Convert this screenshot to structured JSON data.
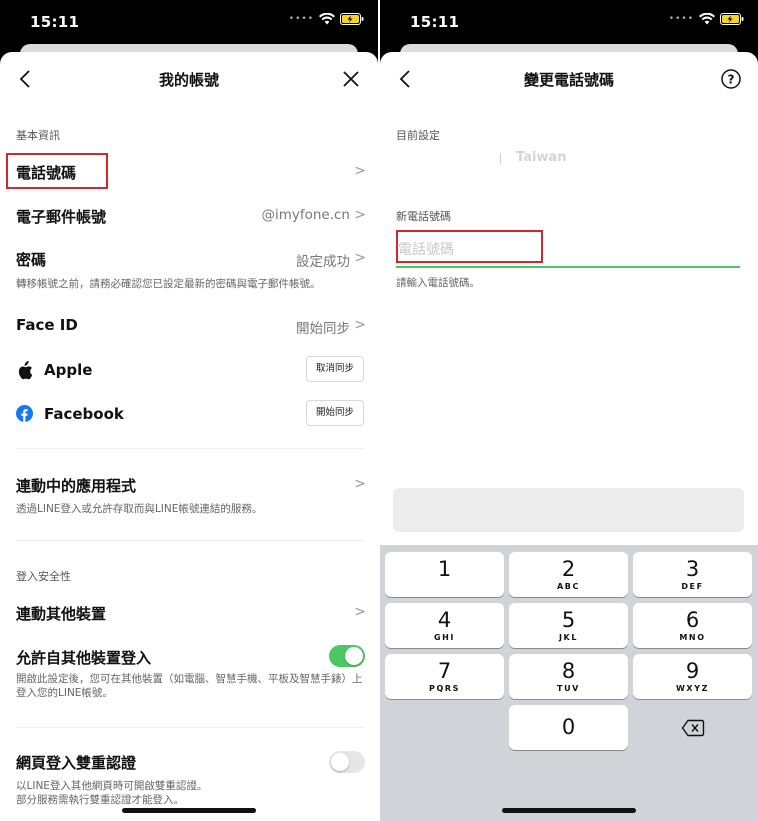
{
  "status_bar": {
    "time": "15:11"
  },
  "left_screen": {
    "title": "我的帳號",
    "basic_info_label": "基本資訊",
    "phone_row": {
      "title": "電話號碼"
    },
    "email_row": {
      "title": "電子郵件帳號",
      "value": "@imyfone.cn"
    },
    "password_row": {
      "title": "密碼",
      "value": "設定成功",
      "note": "轉移帳號之前，請務必確認您已設定最新的密碼與電子郵件帳號。"
    },
    "faceid_row": {
      "title": "Face ID",
      "value": "開始同步"
    },
    "apple_row": {
      "title": "Apple",
      "button": "取消同步"
    },
    "facebook_row": {
      "title": "Facebook",
      "button": "開始同步"
    },
    "linked_apps_row": {
      "title": "連動中的應用程式",
      "note": "透過LINE登入或允許存取而與LINE帳號連結的服務。"
    },
    "login_security_label": "登入安全性",
    "link_devices_row": {
      "title": "連動其他裝置"
    },
    "allow_login_row": {
      "title": "允許自其他裝置登入",
      "note": "開啟此設定後，您可在其他裝置（如電腦、智慧手機、平板及智慧手錶）上登入您的LINE帳號。",
      "enabled": true
    },
    "web_2fa_row": {
      "title": "網頁登入雙重認證",
      "note_line1": "以LINE登入其他網頁時可開啟雙重認證。",
      "note_line2": "部分服務需執行雙重認證才能登入。",
      "enabled": false
    }
  },
  "right_screen": {
    "title": "變更電話號碼",
    "current_label": "目前設定",
    "current_country": "Taiwan",
    "new_label": "新電話號碼",
    "input_placeholder": "電話號碼",
    "input_value": "",
    "hint": "請輸入電話號碼。",
    "keypad": [
      {
        "num": "1",
        "letters": ""
      },
      {
        "num": "2",
        "letters": "ABC"
      },
      {
        "num": "3",
        "letters": "DEF"
      },
      {
        "num": "4",
        "letters": "GHI"
      },
      {
        "num": "5",
        "letters": "JKL"
      },
      {
        "num": "6",
        "letters": "MNO"
      },
      {
        "num": "7",
        "letters": "PQRS"
      },
      {
        "num": "8",
        "letters": "TUV"
      },
      {
        "num": "9",
        "letters": "WXYZ"
      },
      {
        "num": "0",
        "letters": ""
      }
    ]
  },
  "colors": {
    "line_green": "#4cc764",
    "highlight_red": "#d0282e",
    "facebook_blue": "#1877f2"
  },
  "icons": [
    "back-chevron-icon",
    "close-icon",
    "help-icon",
    "apple-icon",
    "facebook-icon",
    "delete-icon",
    "wifi-icon",
    "battery-icon",
    "chevron-right-icon"
  ]
}
